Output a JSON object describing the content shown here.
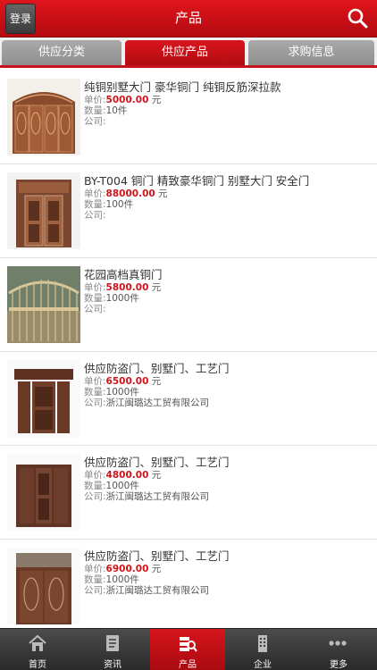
{
  "header": {
    "login_label": "登录",
    "title": "产品"
  },
  "tabs": [
    {
      "label": "供应分类",
      "active": false
    },
    {
      "label": "供应产品",
      "active": true
    },
    {
      "label": "求购信息",
      "active": false
    }
  ],
  "field_labels": {
    "price": "单价:",
    "qty": "数量:",
    "company": "公司:",
    "currency": "元"
  },
  "products": [
    {
      "name": "纯铜别墅大门 豪华铜门 纯铜反筋深拉款",
      "price": "5000.00",
      "qty": "10件",
      "company": ""
    },
    {
      "name": "BY-T004 铜门 精致豪华铜门 别墅大门 安全门",
      "price": "88000.00",
      "qty": "100件",
      "company": ""
    },
    {
      "name": "花园高档真铜门",
      "price": "5800.00",
      "qty": "1000件",
      "company": ""
    },
    {
      "name": "供应防盗门、别墅门、工艺门",
      "price": "6500.00",
      "qty": "1000件",
      "company": "浙江闽璐达工贸有限公司"
    },
    {
      "name": "供应防盗门、别墅门、工艺门",
      "price": "4800.00",
      "qty": "1000件",
      "company": "浙江闽璐达工贸有限公司"
    },
    {
      "name": "供应防盗门、别墅门、工艺门",
      "price": "6900.00",
      "qty": "1000件",
      "company": "浙江闽璐达工贸有限公司"
    }
  ],
  "tabbar": [
    {
      "label": "首页",
      "icon": "home-icon",
      "active": false
    },
    {
      "label": "资讯",
      "icon": "news-icon",
      "active": false
    },
    {
      "label": "产品",
      "icon": "products-icon",
      "active": true
    },
    {
      "label": "企业",
      "icon": "building-icon",
      "active": false
    },
    {
      "label": "更多",
      "icon": "more-icon",
      "active": false
    }
  ],
  "colors": {
    "brand_red": "#c4131a",
    "price_red": "#d0141a",
    "tab_gray": "#9a9a9a",
    "bar_dark": "#333333"
  }
}
